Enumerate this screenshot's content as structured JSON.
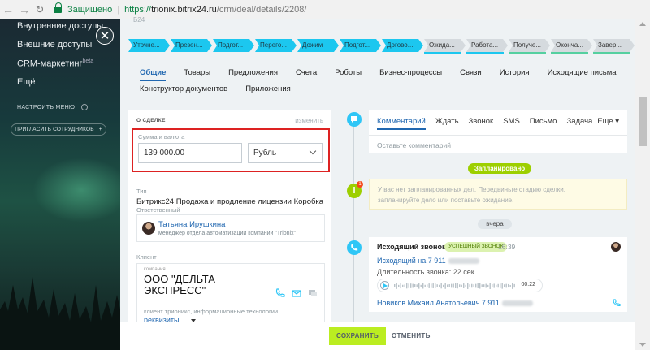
{
  "browser": {
    "secure_label": "Защищено",
    "url_scheme": "https://",
    "url_host": "trionix.bitrix24.ru",
    "url_path": "/crm/deal/details/2208/"
  },
  "sidebar": {
    "items": [
      {
        "label": "Внутренние доступы"
      },
      {
        "label": "Внешние доступы"
      },
      {
        "label": "CRM-маркетинг",
        "badge": "beta"
      },
      {
        "label": "Ещё"
      }
    ],
    "settings_label": "НАСТРОИТЬ МЕНЮ",
    "invite_label": "ПРИГЛАСИТЬ СОТРУДНИКОВ"
  },
  "deal": {
    "id_label": "Б24"
  },
  "stages": [
    {
      "label": "Уточне...",
      "state": "done",
      "color": "#1cc7ef"
    },
    {
      "label": "Презен...",
      "state": "done",
      "color": "#1cc7ef"
    },
    {
      "label": "Подгот...",
      "state": "done",
      "color": "#1cc7ef"
    },
    {
      "label": "Перего...",
      "state": "done",
      "color": "#1cc7ef"
    },
    {
      "label": "Дожим",
      "state": "done",
      "color": "#1cc7ef"
    },
    {
      "label": "Подгот...",
      "state": "done",
      "color": "#1cc7ef"
    },
    {
      "label": "Догово...",
      "state": "done",
      "color": "#1cc7ef"
    },
    {
      "label": "Ожида...",
      "state": "pending",
      "color": "#d5dade"
    },
    {
      "label": "Работа...",
      "state": "pending",
      "color": "#d5dade"
    },
    {
      "label": "Получе...",
      "state": "pending",
      "color": "#d5dade"
    },
    {
      "label": "Оконча...",
      "state": "pending",
      "color": "#d5dade"
    },
    {
      "label": "Завер...",
      "state": "pending",
      "color": "#d5dade"
    }
  ],
  "tabs_row1": [
    {
      "label": "Общие",
      "active": true
    },
    {
      "label": "Товары"
    },
    {
      "label": "Предложения"
    },
    {
      "label": "Счета"
    },
    {
      "label": "Роботы"
    },
    {
      "label": "Бизнес-процессы"
    },
    {
      "label": "Связи"
    },
    {
      "label": "История"
    },
    {
      "label": "Исходящие письма"
    }
  ],
  "tabs_row2": [
    {
      "label": "Конструктор документов"
    },
    {
      "label": "Приложения"
    }
  ],
  "about": {
    "title": "О СДЕЛКЕ",
    "edit_label": "изменить",
    "sum_label": "Сумма и валюта",
    "sum_value": "139 000.00",
    "currency": "Рубль",
    "type_label": "Тип",
    "type_value": "Битрикс24 Продажа и продление лицензии Коробка",
    "responsible_label": "Ответственный",
    "responsible_name": "Татьяна Ирушкина",
    "responsible_position": "менеджер отдела автоматизации компании \"Trionix\"",
    "client_label": "Клиент",
    "client_type": "компания",
    "client_name": "ООО \"ДЕЛЬТА ЭКСПРЕСС\"",
    "client_sub": "клиент трионикс, информационные технологии",
    "client_link": "реквизиты"
  },
  "timeline": {
    "tabs": [
      {
        "label": "Комментарий",
        "active": true
      },
      {
        "label": "Ждать"
      },
      {
        "label": "Звонок"
      },
      {
        "label": "SMS"
      },
      {
        "label": "Письмо"
      },
      {
        "label": "Задача"
      }
    ],
    "more_label": "Еще",
    "comment_placeholder": "Оставьте комментарий",
    "planned_label": "Запланировано",
    "empty_line1": "У вас нет запланированных дел. Передвиньте стадию сделки,",
    "empty_line2": "запланируйте дело или поставьте ожидание.",
    "yesterday_label": "вчера",
    "call": {
      "title": "Исходящий звонок",
      "badge": "УСПЕШНЫЙ ЗВОНОК",
      "time": "16:39",
      "link": "Исходящий на 7 911",
      "duration": "Длительность звонка: 22 сек.",
      "player_time": "00:22",
      "person": "Новиков Михаил Анатольевич 7 911"
    }
  },
  "footer": {
    "save_label": "СОХРАНИТЬ",
    "cancel_label": "ОТМЕНИТЬ"
  },
  "colors": {
    "accent_blue": "#2067b0",
    "stage_active": "#1cc7ef",
    "save_green": "#bbed21",
    "planned_green": "#9dcf00",
    "highlight_red": "#dd2222"
  }
}
